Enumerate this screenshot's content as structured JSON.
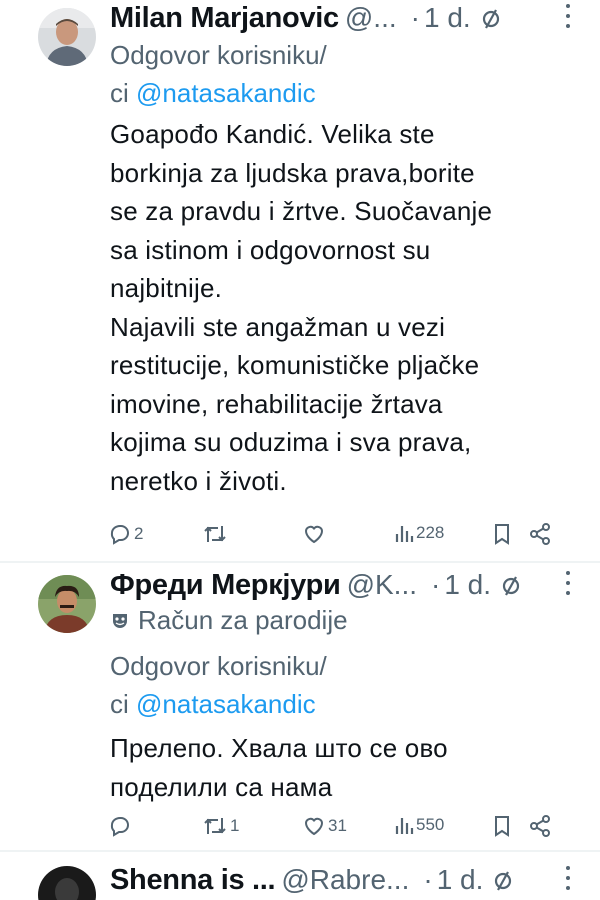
{
  "tweets": [
    {
      "name": "Milan Marjanovic",
      "handle": "@...",
      "time": "1 d.",
      "reply_label": "Odgovor korisniku/",
      "reply_prefix": "ci",
      "reply_handle": "@natasakandic",
      "text_lines": [
        "Goapođo Kandić. Velika ste",
        "borkinja za ljudska prava,borite",
        "se za pravdu i žrtve. Suočavanje",
        "sa istinom i odgovornost su",
        "najbitnije.",
        "Najavili ste angažman u vezi",
        "restitucije, komunističke pljačke",
        "imovine, rehabilitacije žrtava",
        "kojima su oduzima i sva prava,",
        "neretko i životi."
      ],
      "replies": "2",
      "reposts": "",
      "likes": "",
      "views": "228"
    },
    {
      "name": "Фреди Меркјури",
      "handle": "@K...",
      "time": "1 d.",
      "parody_label": "Račun za parodije",
      "reply_label": "Odgovor korisniku/",
      "reply_prefix": "ci",
      "reply_handle": "@natasakandic",
      "text_lines": [
        "Прелепо. Хвала што се ово",
        "поделили са нама"
      ],
      "replies": "",
      "reposts": "1",
      "likes": "31",
      "views": "550"
    },
    {
      "name": "Shenna is ...",
      "handle": "@Rabre...",
      "time": "1 d."
    }
  ],
  "colors": {
    "text": "#0f1419",
    "secondary": "#536471",
    "link": "#1d9bf0",
    "divider": "#eff3f4"
  }
}
